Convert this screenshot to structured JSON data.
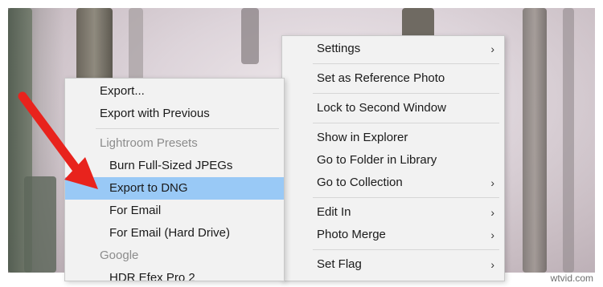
{
  "left_menu": {
    "items": [
      {
        "label": "Export..."
      },
      {
        "label": "Export with Previous"
      }
    ],
    "group_header": "Lightroom Presets",
    "preset_items": [
      {
        "label": "Burn Full-Sized JPEGs"
      },
      {
        "label": "Export to DNG"
      },
      {
        "label": "For Email"
      },
      {
        "label": "For Email (Hard Drive)"
      }
    ],
    "google_header": "Google",
    "partial_item": "HDR Efex Pro 2"
  },
  "right_menu": {
    "settings": "Settings",
    "set_reference": "Set as Reference Photo",
    "lock_second_window": "Lock to Second Window",
    "show_in_explorer": "Show in Explorer",
    "go_to_folder": "Go to Folder in Library",
    "go_to_collection": "Go to Collection",
    "edit_in": "Edit In",
    "photo_merge": "Photo Merge",
    "set_flag": "Set Flag",
    "submenu_glyph": "›"
  },
  "annotation": {
    "arrow_color": "#e8231d"
  },
  "highlight_color": "#99c9f6",
  "watermark": "wtvid.com"
}
